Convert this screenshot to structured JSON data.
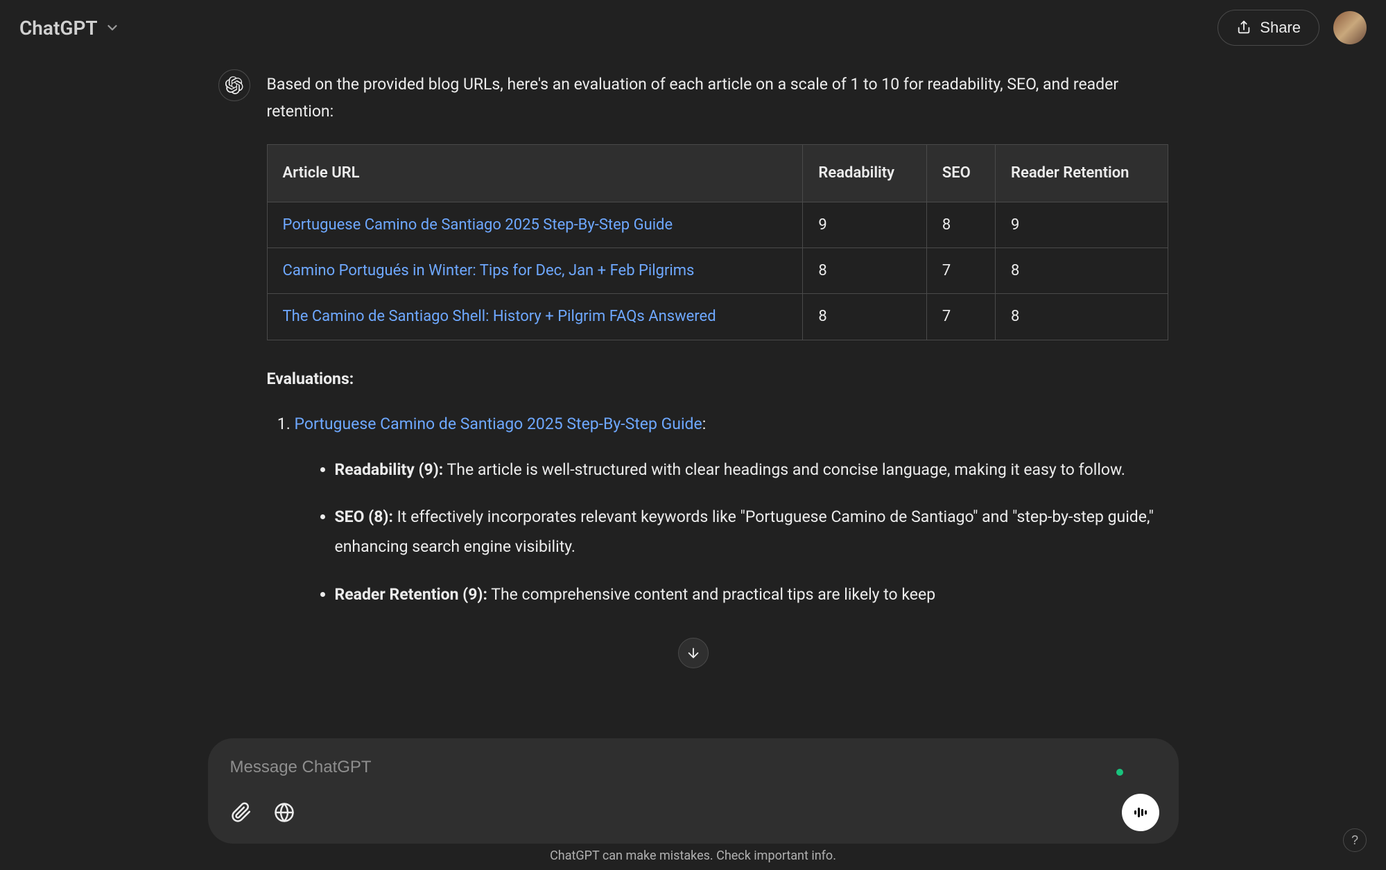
{
  "header": {
    "brand": "ChatGPT",
    "share_label": "Share"
  },
  "message": {
    "intro": "Based on the provided blog URLs, here's an evaluation of each article on a scale of 1 to 10 for readability, SEO, and reader retention:",
    "table": {
      "headers": {
        "url": "Article URL",
        "readability": "Readability",
        "seo": "SEO",
        "retention": "Reader Retention"
      },
      "rows": [
        {
          "url": "Portuguese Camino de Santiago 2025 Step-By-Step Guide",
          "readability": "9",
          "seo": "8",
          "retention": "9"
        },
        {
          "url": "Camino Portugués in Winter: Tips for Dec, Jan + Feb Pilgrims",
          "readability": "8",
          "seo": "7",
          "retention": "8"
        },
        {
          "url": "The Camino de Santiago Shell: History + Pilgrim FAQs Answered",
          "readability": "8",
          "seo": "7",
          "retention": "8"
        }
      ]
    },
    "evaluations_heading": "Evaluations:",
    "evaluation_1": {
      "title": "Portuguese Camino de Santiago 2025 Step-By-Step Guide",
      "colon": ":",
      "readability_label": "Readability (9):",
      "readability_text": " The article is well-structured with clear headings and concise language, making it easy to follow.",
      "seo_label": "SEO (8):",
      "seo_text": " It effectively incorporates relevant keywords like \"Portuguese Camino de Santiago\" and \"step-by-step guide,\" enhancing search engine visibility.",
      "retention_label": "Reader Retention (9):",
      "retention_text": " The comprehensive content and practical tips are likely to keep"
    }
  },
  "composer": {
    "placeholder": "Message ChatGPT"
  },
  "footer": {
    "disclaimer": "ChatGPT can make mistakes. Check important info.",
    "help": "?"
  }
}
